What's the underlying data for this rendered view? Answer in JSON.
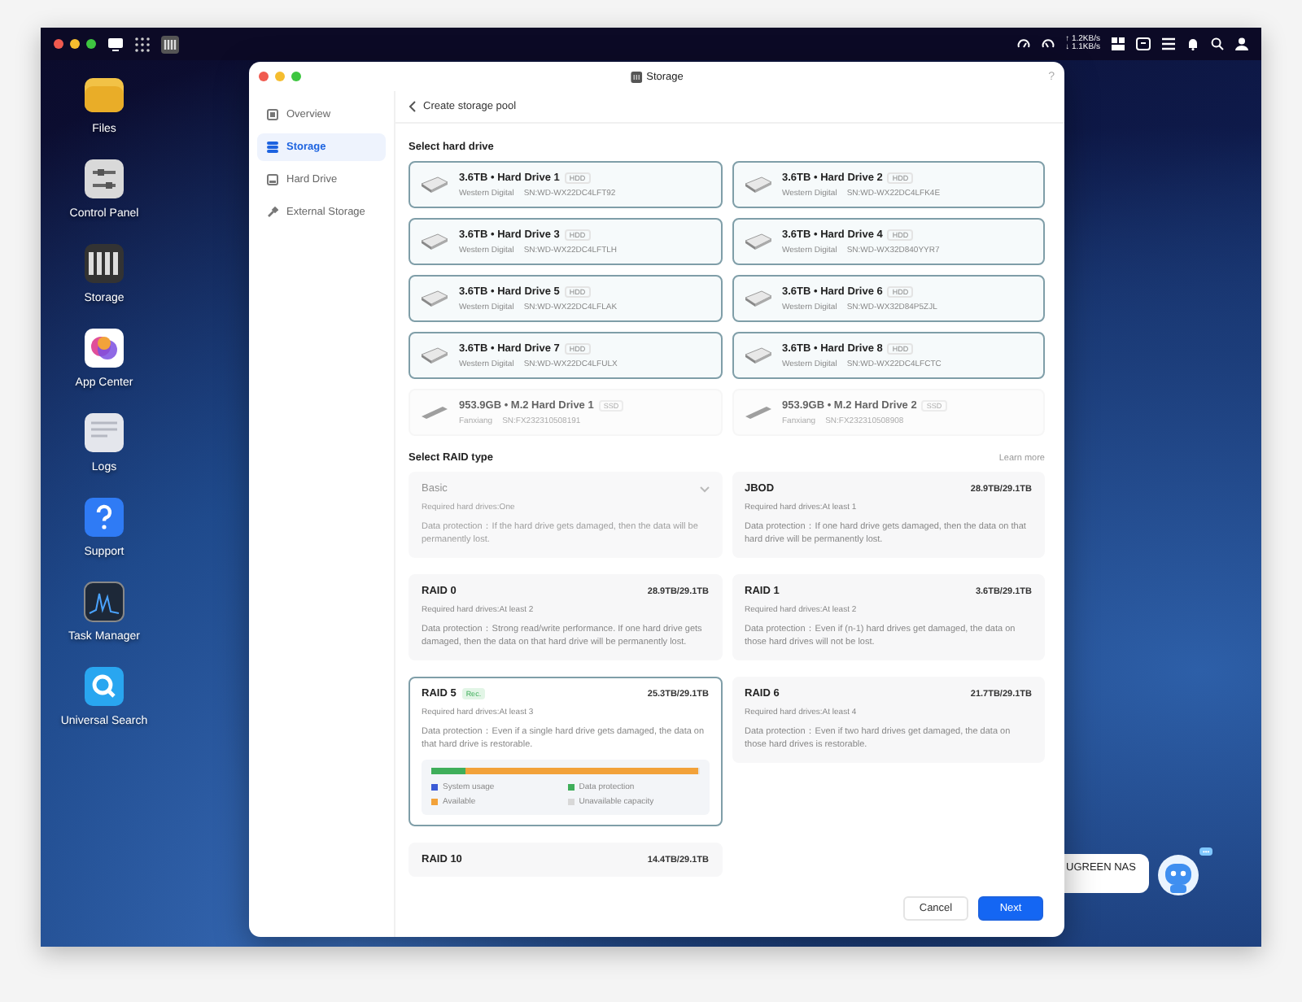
{
  "topbar": {
    "apps": [
      {
        "kind": "monitor"
      },
      {
        "kind": "grid"
      },
      {
        "kind": "storage"
      }
    ],
    "net_speed": {
      "up": "↑ 1.2KB/s",
      "down": "↓ 1.1KB/s"
    }
  },
  "desktop_icons": [
    {
      "kind": "files",
      "label": "Files"
    },
    {
      "kind": "control",
      "label": "Control Panel"
    },
    {
      "kind": "storage",
      "label": "Storage"
    },
    {
      "kind": "appcenter",
      "label": "App Center"
    },
    {
      "kind": "logs",
      "label": "Logs"
    },
    {
      "kind": "support",
      "label": "Support"
    },
    {
      "kind": "taskmanager",
      "label": "Task Manager"
    },
    {
      "kind": "search",
      "label": "Universal Search"
    }
  ],
  "window": {
    "title": "Storage",
    "help": "?"
  },
  "sidebar": {
    "items": [
      {
        "kind": "overview",
        "label": "Overview",
        "selected": false
      },
      {
        "kind": "storage",
        "label": "Storage",
        "selected": true
      },
      {
        "kind": "drive",
        "label": "Hard Drive",
        "selected": false
      },
      {
        "kind": "external",
        "label": "External Storage",
        "selected": false
      }
    ]
  },
  "header": {
    "title": "Create storage pool"
  },
  "drive_section": {
    "title": "Select hard drive",
    "drives": [
      {
        "kind": "hdd",
        "name": "3.6TB • Hard Drive 1",
        "type": "HDD",
        "vendor": "Western Digital",
        "serial": "SN:WD-WX22DC4LFT92",
        "disabled": false
      },
      {
        "kind": "hdd",
        "name": "3.6TB • Hard Drive 2",
        "type": "HDD",
        "vendor": "Western Digital",
        "serial": "SN:WD-WX22DC4LFK4E",
        "disabled": false
      },
      {
        "kind": "hdd",
        "name": "3.6TB • Hard Drive 3",
        "type": "HDD",
        "vendor": "Western Digital",
        "serial": "SN:WD-WX22DC4LFTLH",
        "disabled": false
      },
      {
        "kind": "hdd",
        "name": "3.6TB • Hard Drive 4",
        "type": "HDD",
        "vendor": "Western Digital",
        "serial": "SN:WD-WX32D840YYR7",
        "disabled": false
      },
      {
        "kind": "hdd",
        "name": "3.6TB • Hard Drive 5",
        "type": "HDD",
        "vendor": "Western Digital",
        "serial": "SN:WD-WX22DC4LFLAK",
        "disabled": false
      },
      {
        "kind": "hdd",
        "name": "3.6TB • Hard Drive 6",
        "type": "HDD",
        "vendor": "Western Digital",
        "serial": "SN:WD-WX32D84P5ZJL",
        "disabled": false
      },
      {
        "kind": "hdd",
        "name": "3.6TB • Hard Drive 7",
        "type": "HDD",
        "vendor": "Western Digital",
        "serial": "SN:WD-WX22DC4LFULX",
        "disabled": false
      },
      {
        "kind": "hdd",
        "name": "3.6TB • Hard Drive 8",
        "type": "HDD",
        "vendor": "Western Digital",
        "serial": "SN:WD-WX22DC4LFCTC",
        "disabled": false
      },
      {
        "kind": "ssd",
        "name": "953.9GB • M.2 Hard Drive 1",
        "type": "SSD",
        "vendor": "Fanxiang",
        "serial": "SN:FX232310508191",
        "disabled": true
      },
      {
        "kind": "ssd",
        "name": "953.9GB • M.2 Hard Drive 2",
        "type": "SSD",
        "vendor": "Fanxiang",
        "serial": "SN:FX232310508908",
        "disabled": true
      }
    ]
  },
  "raid_section": {
    "title": "Select RAID type",
    "learn_more": "Learn more",
    "options": [
      {
        "kind": "dropdown",
        "name": "Basic",
        "requirement": "Required hard drives:One",
        "protection": "Data protection：If the hard drive gets damaged, then the data will be permanently lost.",
        "disabled": true,
        "selected": false
      },
      {
        "kind": "plain",
        "name": "JBOD",
        "capacity": "28.9TB/29.1TB",
        "requirement": "Required hard drives:At least 1",
        "protection": "Data protection：If one hard drive gets damaged, then the data on that hard drive will be permanently lost.",
        "disabled": false,
        "selected": false
      },
      {
        "kind": "plain",
        "name": "RAID 0",
        "capacity": "28.9TB/29.1TB",
        "requirement": "Required hard drives:At least 2",
        "protection": "Data protection：Strong read/write performance. If one hard drive gets damaged, then the data on that hard drive will be permanently lost.",
        "disabled": false,
        "selected": false
      },
      {
        "kind": "plain",
        "name": "RAID 1",
        "capacity": "3.6TB/29.1TB",
        "requirement": "Required hard drives:At least 2",
        "protection": "Data protection：Even if (n-1) hard drives get damaged, the data on those hard drives will not be lost.",
        "disabled": false,
        "selected": false
      },
      {
        "kind": "usage",
        "name": "RAID 5",
        "badge": "Rec.",
        "capacity": "25.3TB/29.1TB",
        "requirement": "Required hard drives:At least 3",
        "protection": "Data protection：Even if a single hard drive gets damaged, the data on that hard drive is restorable.",
        "disabled": false,
        "selected": true,
        "usage": {
          "segments": [
            {
              "color": "#3fae5a",
              "level": 0.13
            },
            {
              "color": "#f2a23a",
              "level": 0.87
            }
          ],
          "legend": [
            {
              "label": "System usage",
              "color": "#3b5bd6"
            },
            {
              "label": "Data protection",
              "color": "#3fae5a"
            },
            {
              "label": "Available",
              "color": "#f2a23a"
            },
            {
              "label": "Unavailable capacity",
              "color": "#d8d8d8"
            }
          ]
        }
      },
      {
        "kind": "plain",
        "name": "RAID 6",
        "capacity": "21.7TB/29.1TB",
        "requirement": "Required hard drives:At least 4",
        "protection": "Data protection：Even if two hard drives get damaged, the data on those hard drives is restorable.",
        "disabled": false,
        "selected": false
      },
      {
        "kind": "cut",
        "name": "RAID 10",
        "capacity": "14.4TB/29.1TB",
        "disabled": false,
        "selected": false
      }
    ]
  },
  "footer": {
    "cancel": "Cancel",
    "next": "Next"
  },
  "assistant": {
    "bubble": "UGREEN NAS",
    "badge": "•••"
  }
}
